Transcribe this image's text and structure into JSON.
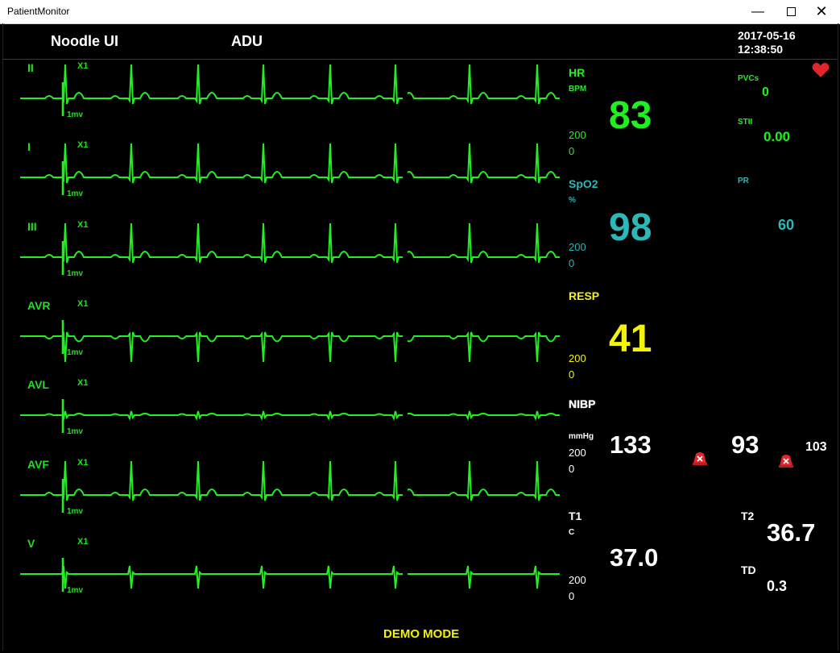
{
  "window": {
    "title": "PatientMonitor"
  },
  "header": {
    "app_name": "Noodle UI",
    "patient_type": "ADU",
    "date": "2017-05-16",
    "time": "12:38:50"
  },
  "leads": [
    {
      "name": "II",
      "gain": "X1",
      "scale": "1mv"
    },
    {
      "name": "I",
      "gain": "X1",
      "scale": "1mv"
    },
    {
      "name": "III",
      "gain": "X1",
      "scale": "1mv"
    },
    {
      "name": "AVR",
      "gain": "X1",
      "scale": "1mv"
    },
    {
      "name": "AVL",
      "gain": "X1",
      "scale": "1mv"
    },
    {
      "name": "AVF",
      "gain": "X1",
      "scale": "1mv"
    },
    {
      "name": "V",
      "gain": "X1",
      "scale": "1mv"
    }
  ],
  "hr": {
    "label": "HR",
    "unit": "BPM",
    "value": "83",
    "high": "200",
    "low": "0"
  },
  "pvcs": {
    "label": "PVCs",
    "value": "0"
  },
  "st": {
    "label": "STII",
    "value": "0.00"
  },
  "spo2": {
    "label": "SpO2",
    "unit": "%",
    "value": "98",
    "high": "200",
    "low": "0"
  },
  "pr": {
    "label": "PR",
    "value": "60"
  },
  "resp": {
    "label": "RESP",
    "value": "41",
    "high": "200",
    "low": "0"
  },
  "nibp": {
    "label": "NIBP",
    "unit": "mmHg",
    "systolic": "133",
    "diastolic": "93",
    "mean": "103",
    "high": "200",
    "low": "0"
  },
  "temp": {
    "t1_label": "T1",
    "unit": "C",
    "t1_value": "37.0",
    "high": "200",
    "low": "0",
    "t2_label": "T2",
    "t2_value": "36.7",
    "td_label": "TD",
    "td_value": "0.3"
  },
  "footer": {
    "mode": "DEMO MODE"
  },
  "colors": {
    "ecg": "#22ee22",
    "spo2": "#2ab8b8",
    "resp": "#f2f20a",
    "nibp": "#ffffff",
    "alarm": "#e0262c"
  }
}
